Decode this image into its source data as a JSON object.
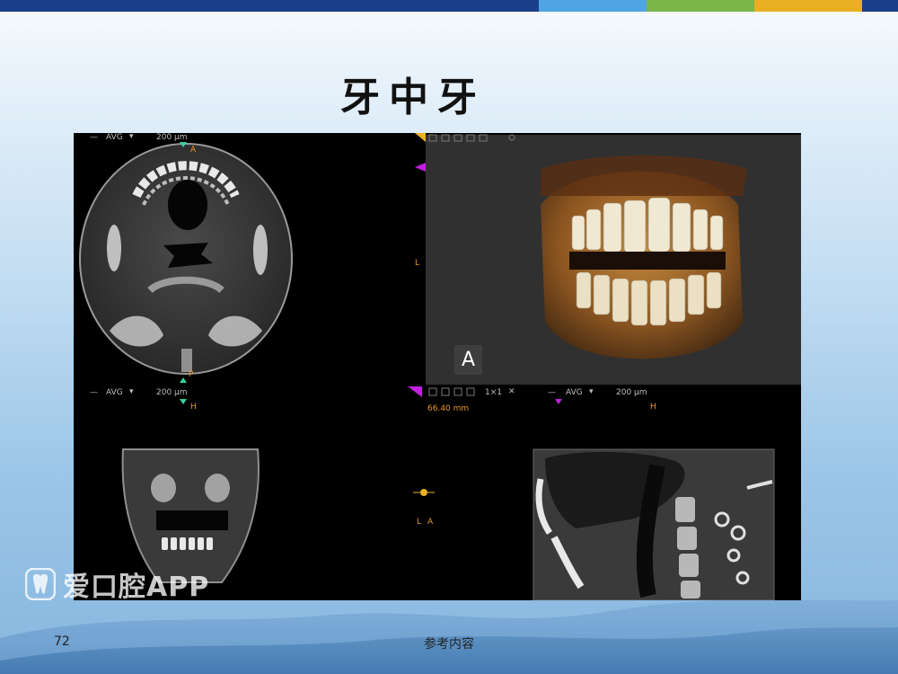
{
  "colors": {
    "top_bar": [
      "#1a3f8a",
      "#4fa5e4",
      "#7ab648",
      "#e8b021",
      "#1a3f8a"
    ],
    "panel_bg": "#000000",
    "render_bg": "#303030",
    "overlay_orange": "#e8952a",
    "marker_magenta": "#c21fe0",
    "marker_green": "#2fd3a0"
  },
  "slide": {
    "title": "牙中牙",
    "page_number": "72",
    "footer_note": "参考内容",
    "watermark": "爱口腔APP"
  },
  "viewer": {
    "axial": {
      "avg_label": "AVG",
      "thickness": "200 μm",
      "orient_top": "A",
      "orient_bottom": "P"
    },
    "render3d": {
      "orient_side": "L",
      "orient_cube": "A"
    },
    "coronal": {
      "avg_label": "AVG",
      "thickness": "200 μm",
      "orient_top": "H"
    },
    "center_tools": {
      "layout": "1×1",
      "measure": "66.40 mm",
      "orient_l": "L",
      "orient_a": "A"
    },
    "sagittal": {
      "avg_label": "AVG",
      "thickness": "200 μm",
      "orient_top": "H"
    }
  }
}
